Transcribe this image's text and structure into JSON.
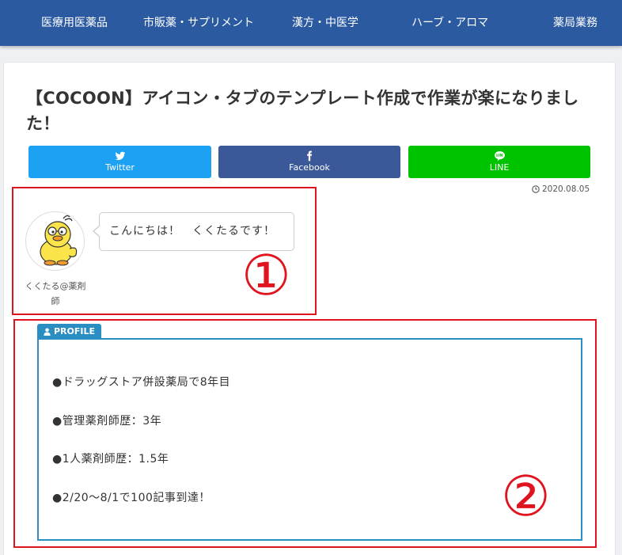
{
  "nav": {
    "items": [
      "医療用医薬品",
      "市販薬・サプリメント",
      "漢方・中医学",
      "ハーブ・アロマ",
      "薬局業務"
    ]
  },
  "article": {
    "title": "【COCOON】アイコン・タブのテンプレート作成で作業が楽になりました！",
    "date": "2020.08.05"
  },
  "share": {
    "twitter": "Twitter",
    "facebook": "Facebook",
    "line": "LINE"
  },
  "balloon": {
    "name": "くくたる@薬剤師",
    "text": "こんにちは！　くくたるです！"
  },
  "annotations": {
    "one": "①",
    "two": "②",
    "color": "#e0141e"
  },
  "profile": {
    "tab_label": "PROFILE",
    "lines": [
      "●ドラッグストア併設薬局で8年目",
      "●管理薬剤師歴：3年",
      "●1人薬剤師歴：1.5年",
      "●2/20〜8/1で100記事到達！"
    ],
    "accent": "#2b8ec2"
  },
  "colors": {
    "nav": "#2b5aa0",
    "twitter": "#1da1f2",
    "facebook": "#3b5998",
    "line": "#00c300"
  }
}
